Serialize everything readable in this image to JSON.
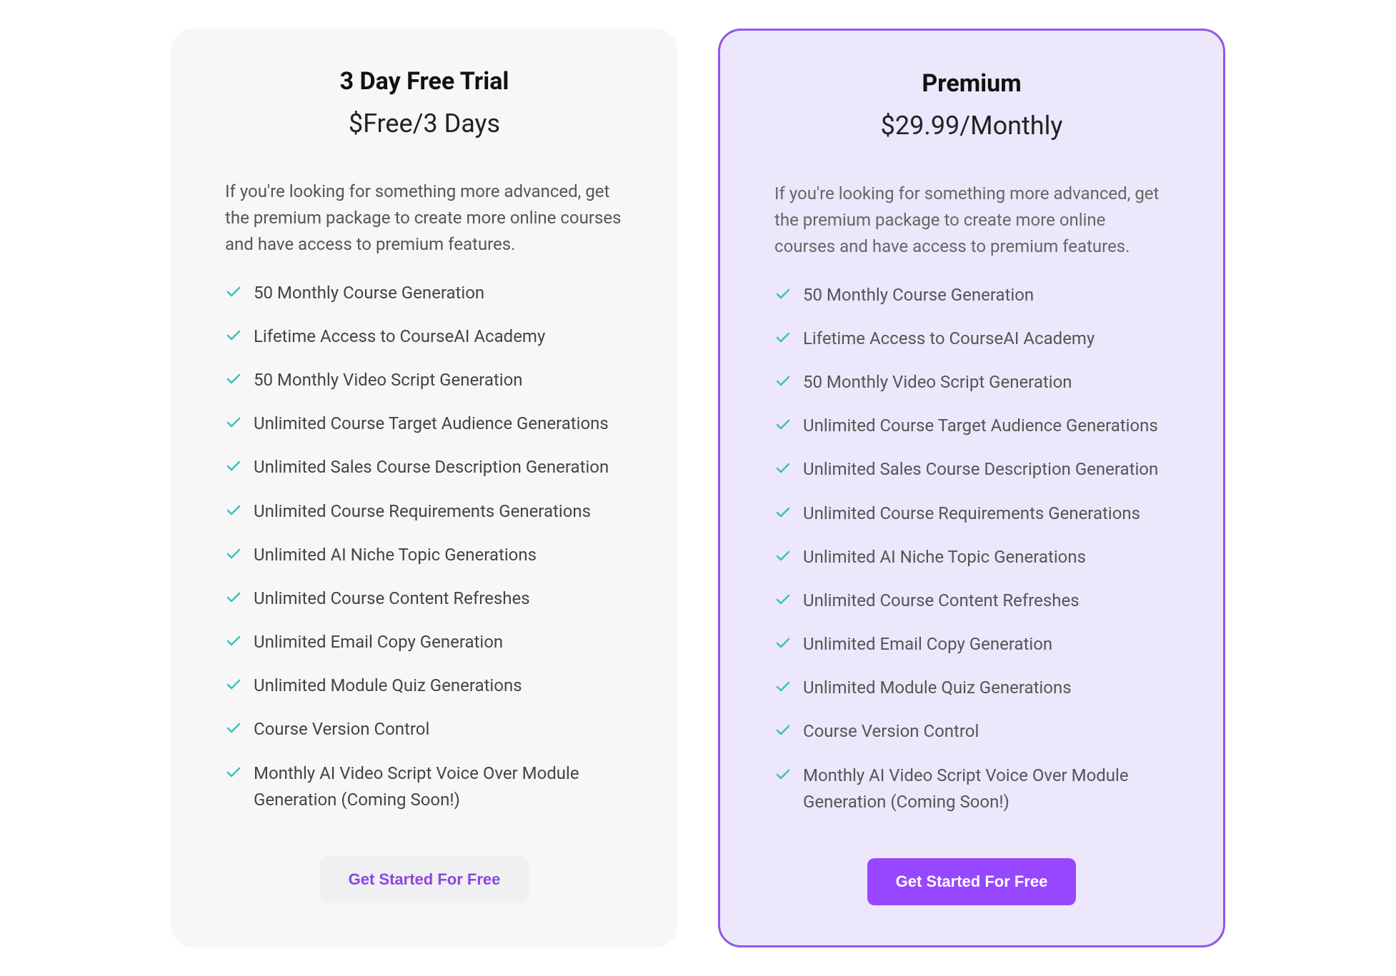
{
  "plans": [
    {
      "title": "3 Day Free Trial",
      "price": "$Free/3 Days",
      "description": "If you're looking for something more advanced, get the premium package to create more online courses and have access to premium features.",
      "features": [
        "50 Monthly Course Generation",
        "Lifetime Access to CourseAI Academy",
        "50 Monthly Video Script Generation",
        "Unlimited Course Target Audience Generations",
        "Unlimited Sales Course Description Generation",
        "Unlimited Course Requirements Generations",
        "Unlimited AI Niche Topic Generations",
        "Unlimited Course Content Refreshes",
        "Unlimited Email Copy Generation",
        "Unlimited Module Quiz Generations",
        "Course Version Control",
        "Monthly AI Video Script Voice Over Module Generation (Coming Soon!)"
      ],
      "cta": "Get Started For Free"
    },
    {
      "title": "Premium",
      "price": "$29.99/Monthly",
      "description": "If you're looking for something more advanced, get the premium package to create more online courses and have access to premium features.",
      "features": [
        "50 Monthly Course Generation",
        "Lifetime Access to CourseAI Academy",
        "50 Monthly Video Script Generation",
        "Unlimited Course Target Audience Generations",
        "Unlimited Sales Course Description Generation",
        "Unlimited Course Requirements Generations",
        "Unlimited AI Niche Topic Generations",
        "Unlimited Course Content Refreshes",
        "Unlimited Email Copy Generation",
        "Unlimited Module Quiz Generations",
        "Course Version Control",
        "Monthly AI Video Script Voice Over Module Generation (Coming Soon!)"
      ],
      "cta": "Get Started For Free"
    }
  ]
}
